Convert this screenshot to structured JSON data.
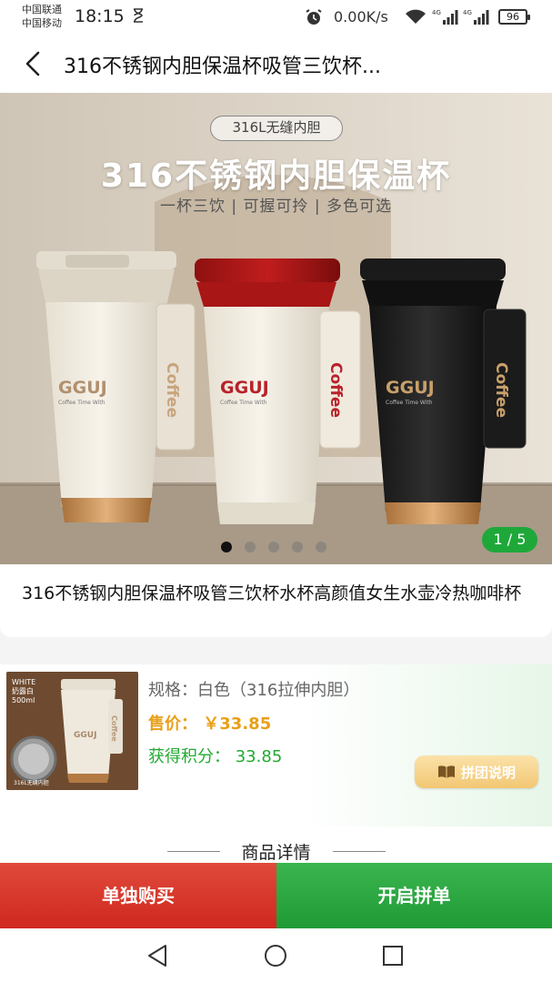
{
  "status_bar": {
    "carrier_1": "中国联通",
    "carrier_2": "中国移动",
    "time": "18:15",
    "net_speed": "0.00K/s",
    "signal_1_label": "4G",
    "signal_2_label": "4G",
    "battery": "96"
  },
  "header": {
    "title": "316不锈钢内胆保温杯吸管三饮杯..."
  },
  "gallery": {
    "badge": "316L无缝内胆",
    "headline": "316不锈钢内胆保温杯",
    "subline": "一杯三饮 | 可握可拎 | 多色可选",
    "cup_brand": "GGUJ",
    "cup_tagline": "Coffee Time With",
    "strap_text": "Coffee",
    "counter": "1 / 5",
    "dot_count": 5,
    "active_dot": 0
  },
  "product": {
    "title": "316不锈钢内胆保温杯吸管三饮杯水杯高颜值女生水壶冷热咖啡杯"
  },
  "spec": {
    "thumb_label_1": "WHITE",
    "thumb_label_2": "奶露白",
    "thumb_label_3": "500ml",
    "thumb_label_4": "316L无缝内胆",
    "spec_text": "规格：白色（316拉伸内胆）",
    "price_label": "售价：",
    "price_value": "￥33.85",
    "points_label": "获得积分：",
    "points_value": "33.85",
    "group_info_label": "拼团说明"
  },
  "details": {
    "heading": "商品详情"
  },
  "actions": {
    "buy_single": "单独购买",
    "start_group": "开启拼单"
  },
  "colors": {
    "buy_red": "#d0281f",
    "group_green": "#1f9a35",
    "price_orange": "#e8a019",
    "points_green": "#22aa33"
  }
}
